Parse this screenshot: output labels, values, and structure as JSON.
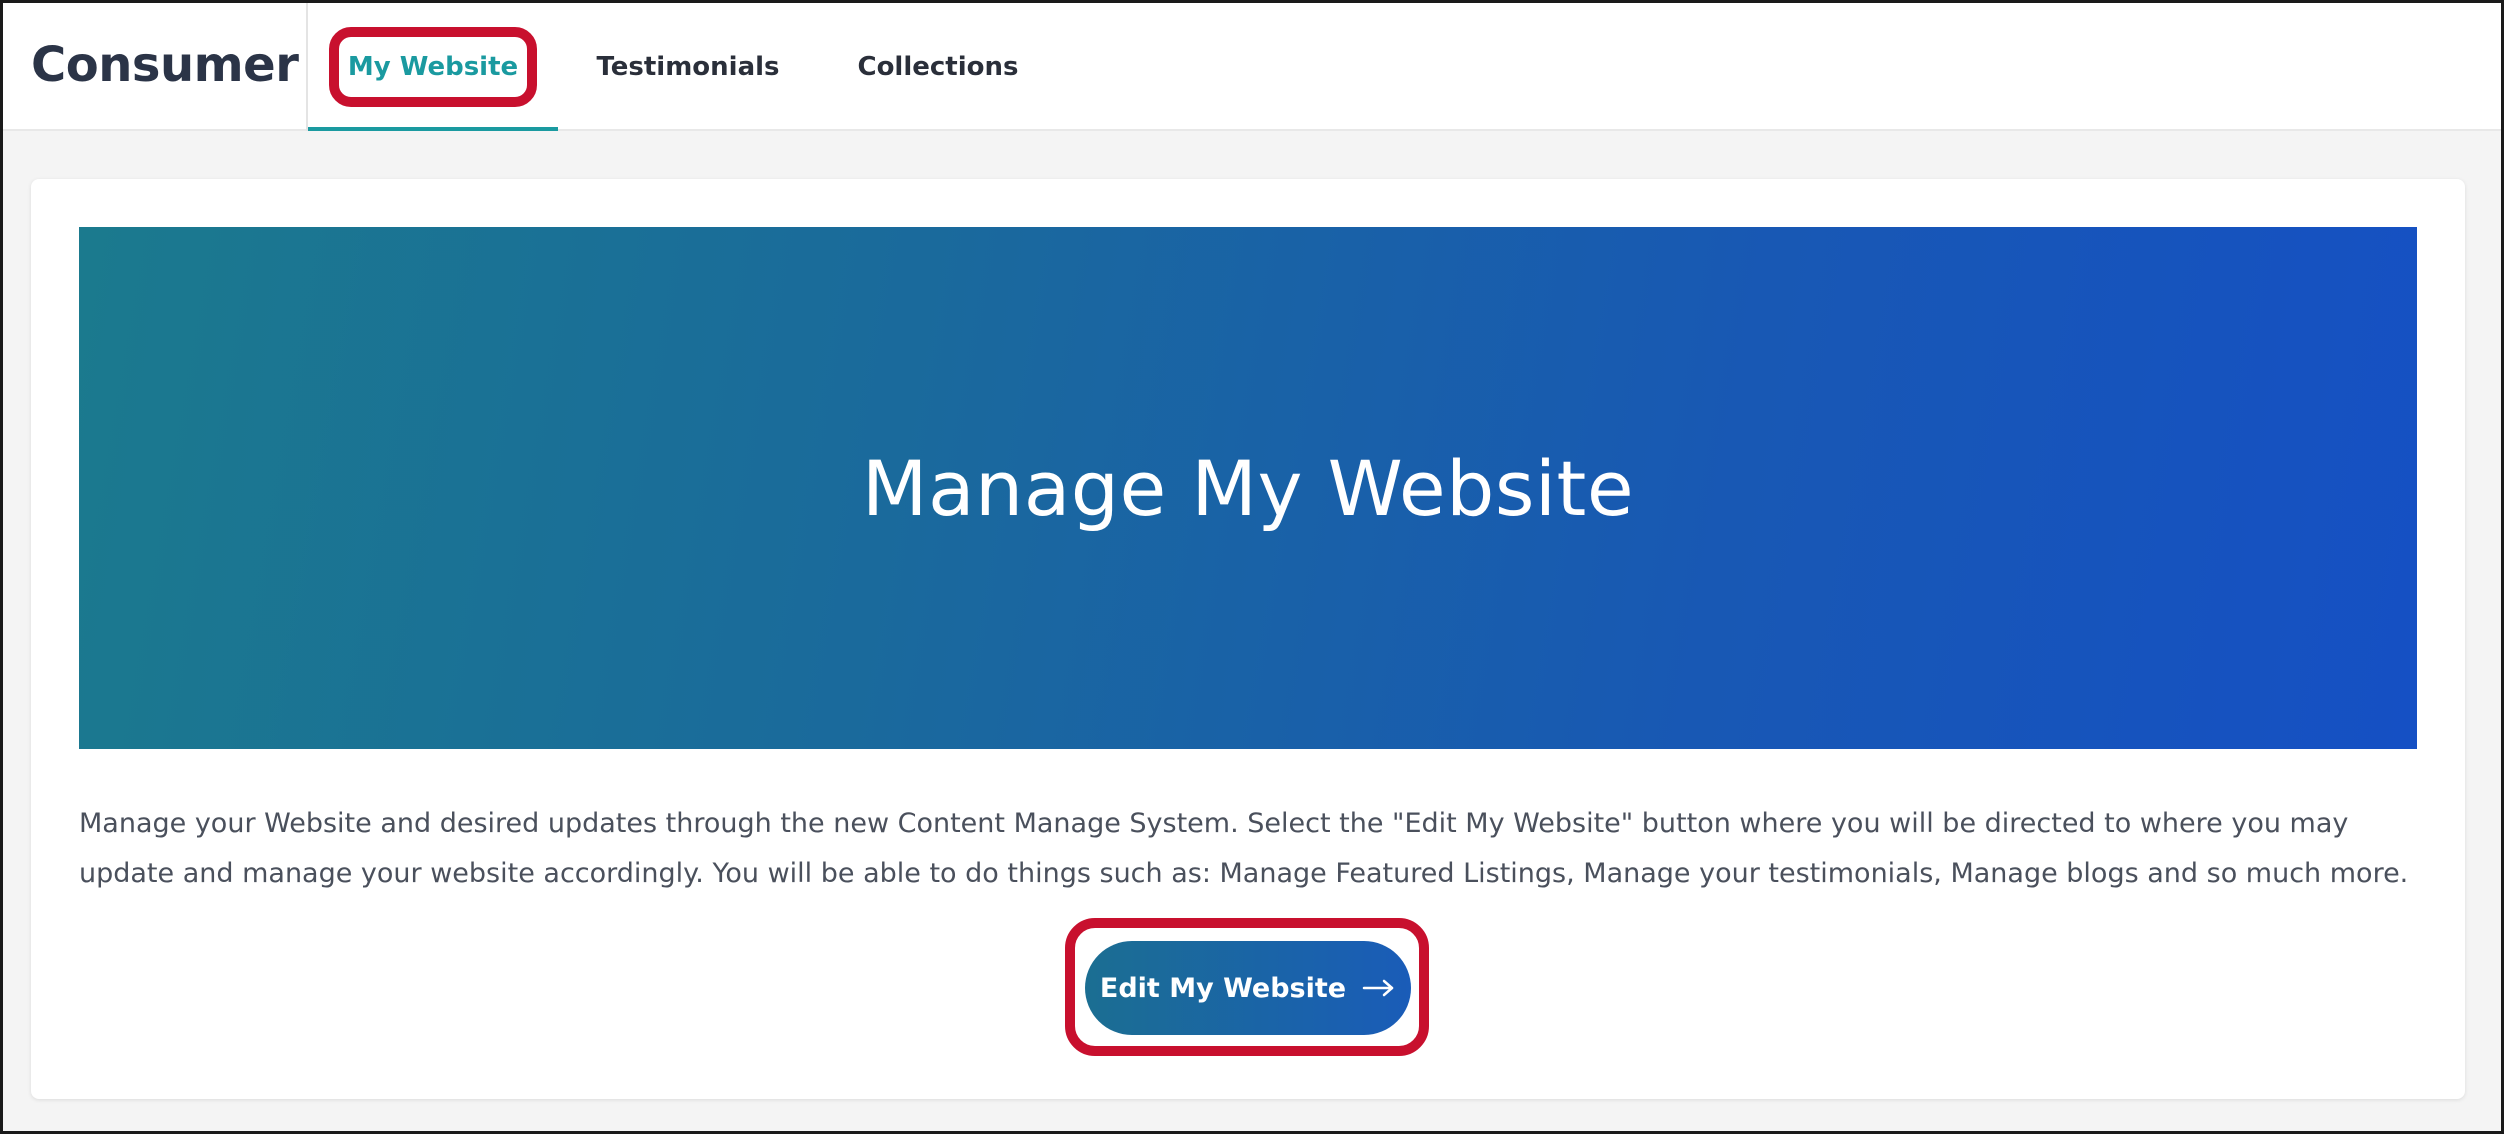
{
  "header": {
    "brand": "Consumer",
    "tabs": [
      {
        "label": "My Website",
        "active": true
      },
      {
        "label": "Testimonials",
        "active": false
      },
      {
        "label": "Collections",
        "active": false
      }
    ]
  },
  "main": {
    "hero_title": "Manage My Website",
    "description": "Manage your Website and desired updates through the new Content Manage System. Select the \"Edit My Website\" button where you will be directed to where you may update and manage your website accordingly. You will be able to do things such as: Manage Featured Listings, Manage your testimonials, Manage blogs and so much more.",
    "edit_button_label": "Edit My Website",
    "edit_button_icon": "arrow-right-icon"
  },
  "colors": {
    "accent_teal": "#1a9aa0",
    "callout_red": "#c8102e",
    "hero_gradient_start": "#1b7a8e",
    "hero_gradient_end": "#1550c4"
  }
}
